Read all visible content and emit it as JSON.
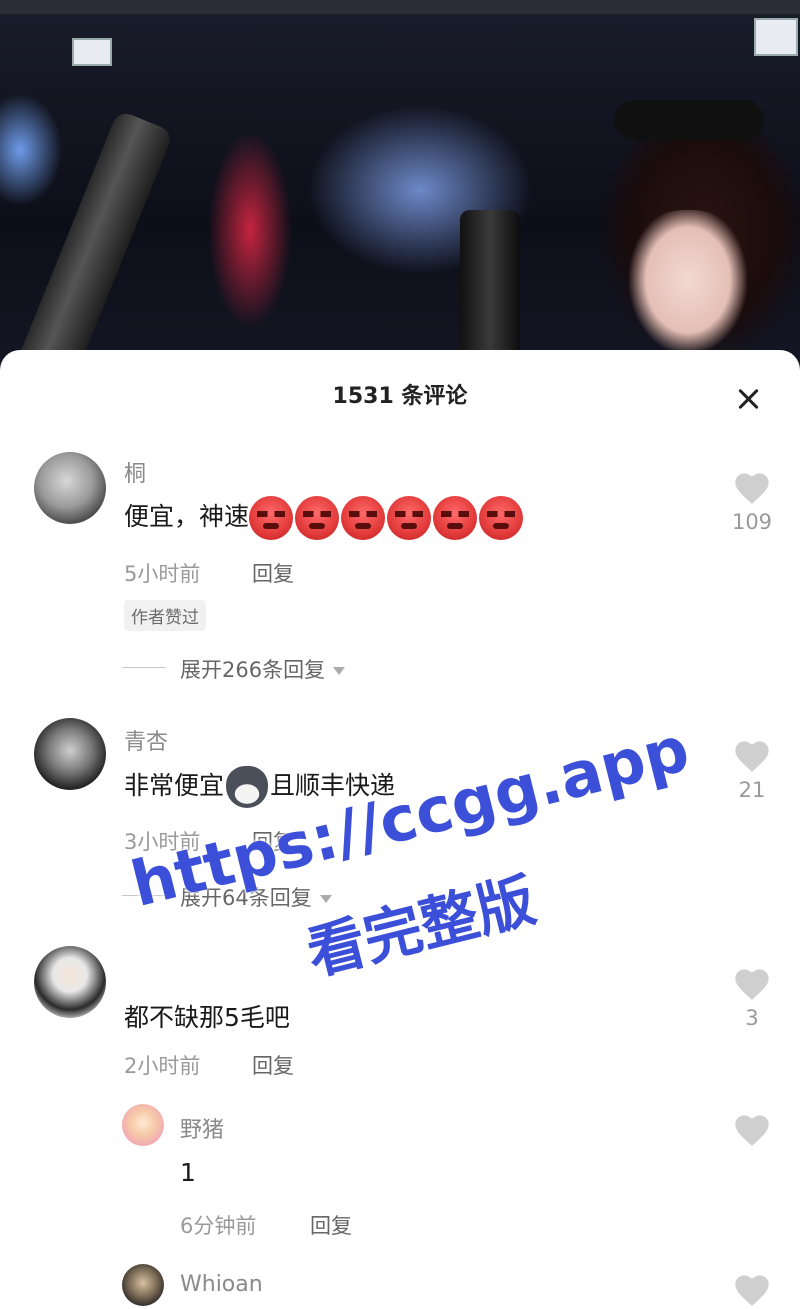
{
  "sheet": {
    "title": "1531 条评论"
  },
  "comments": [
    {
      "user": "桐",
      "text": "便宜，神速",
      "emoji_count": 6,
      "time": "5小时前",
      "reply_label": "回复",
      "badge": "作者赞过",
      "likes": "109",
      "expand": "展开266条回复"
    },
    {
      "user": "青杏",
      "text_before": "非常便宜",
      "text_after": "且顺丰快递",
      "time": "3小时前",
      "reply_label": "回复",
      "likes": "21",
      "expand": "展开64条回复"
    },
    {
      "user": "",
      "text": "都不缺那5毛吧",
      "time": "2小时前",
      "reply_label": "回复",
      "likes": "3"
    }
  ],
  "replies": [
    {
      "user": "野猪",
      "text": "1",
      "time": "6分钟前",
      "reply_label": "回复"
    },
    {
      "user": "Whioan"
    }
  ],
  "watermark": {
    "line1": "https://ccgg.app",
    "line2": "看完整版",
    "color": "#3b4fd8"
  },
  "icons": {
    "like": "heart-icon",
    "close": "close-icon"
  }
}
